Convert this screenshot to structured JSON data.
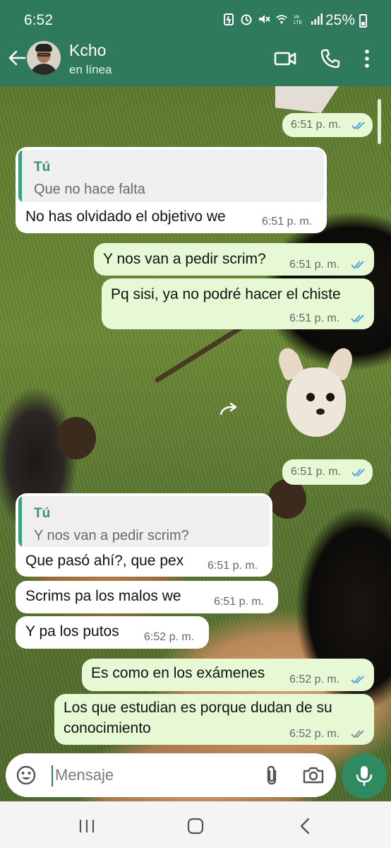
{
  "status_bar": {
    "time": "6:52",
    "battery": "25%"
  },
  "header": {
    "contact_name": "Kcho",
    "presence": "en línea"
  },
  "messages": [
    {
      "time": "6:51 p. m."
    },
    {
      "quote_author": "Tú",
      "quote_text": "Que no hace falta",
      "text": "No has olvidado el objetivo we",
      "time": "6:51 p. m."
    },
    {
      "text": "Y nos van a pedir scrim?",
      "time": "6:51 p. m."
    },
    {
      "text": "Pq sisi, ya no podré hacer el chiste",
      "time": "6:51 p. m."
    },
    {
      "time": "6:51 p. m."
    },
    {
      "quote_author": "Tú",
      "quote_text": "Y nos van a pedir scrim?",
      "text": "Que pasó ahí?, que pex",
      "time": "6:51 p. m."
    },
    {
      "text": "Scrims pa los malos we",
      "time": "6:51 p. m."
    },
    {
      "text": "Y pa los putos",
      "time": "6:52 p. m."
    },
    {
      "text": "Es como en los exámenes",
      "time": "6:52 p. m."
    },
    {
      "text_line1": "Los que estudian es porque dudan de su",
      "text_line2": "conocimiento",
      "time": "6:52 p. m."
    }
  ],
  "composer": {
    "placeholder": "Mensaje"
  },
  "colors": {
    "header": "#2f7a5c",
    "outgoing_bubble": "#e6f8d4",
    "incoming_bubble": "#ffffff",
    "read_ticks": "#4fa3e0",
    "accent": "#2f8a62"
  },
  "icons": [
    "back-arrow-icon",
    "video-call-icon",
    "phone-icon",
    "more-options-icon",
    "emoji-icon",
    "attach-icon",
    "camera-icon",
    "mic-icon",
    "forward-icon"
  ]
}
